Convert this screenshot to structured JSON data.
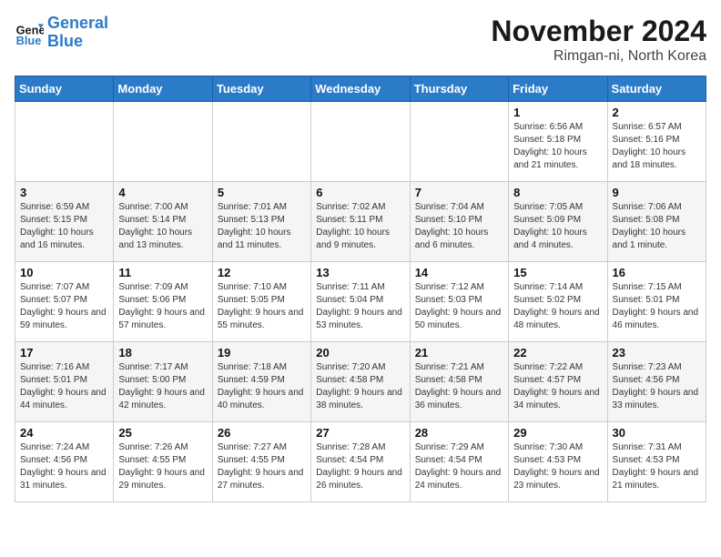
{
  "header": {
    "logo_line1": "General",
    "logo_line2": "Blue",
    "title": "November 2024",
    "subtitle": "Rimgan-ni, North Korea"
  },
  "days_of_week": [
    "Sunday",
    "Monday",
    "Tuesday",
    "Wednesday",
    "Thursday",
    "Friday",
    "Saturday"
  ],
  "weeks": [
    [
      {
        "day": "",
        "info": ""
      },
      {
        "day": "",
        "info": ""
      },
      {
        "day": "",
        "info": ""
      },
      {
        "day": "",
        "info": ""
      },
      {
        "day": "",
        "info": ""
      },
      {
        "day": "1",
        "info": "Sunrise: 6:56 AM\nSunset: 5:18 PM\nDaylight: 10 hours and 21 minutes."
      },
      {
        "day": "2",
        "info": "Sunrise: 6:57 AM\nSunset: 5:16 PM\nDaylight: 10 hours and 18 minutes."
      }
    ],
    [
      {
        "day": "3",
        "info": "Sunrise: 6:59 AM\nSunset: 5:15 PM\nDaylight: 10 hours and 16 minutes."
      },
      {
        "day": "4",
        "info": "Sunrise: 7:00 AM\nSunset: 5:14 PM\nDaylight: 10 hours and 13 minutes."
      },
      {
        "day": "5",
        "info": "Sunrise: 7:01 AM\nSunset: 5:13 PM\nDaylight: 10 hours and 11 minutes."
      },
      {
        "day": "6",
        "info": "Sunrise: 7:02 AM\nSunset: 5:11 PM\nDaylight: 10 hours and 9 minutes."
      },
      {
        "day": "7",
        "info": "Sunrise: 7:04 AM\nSunset: 5:10 PM\nDaylight: 10 hours and 6 minutes."
      },
      {
        "day": "8",
        "info": "Sunrise: 7:05 AM\nSunset: 5:09 PM\nDaylight: 10 hours and 4 minutes."
      },
      {
        "day": "9",
        "info": "Sunrise: 7:06 AM\nSunset: 5:08 PM\nDaylight: 10 hours and 1 minute."
      }
    ],
    [
      {
        "day": "10",
        "info": "Sunrise: 7:07 AM\nSunset: 5:07 PM\nDaylight: 9 hours and 59 minutes."
      },
      {
        "day": "11",
        "info": "Sunrise: 7:09 AM\nSunset: 5:06 PM\nDaylight: 9 hours and 57 minutes."
      },
      {
        "day": "12",
        "info": "Sunrise: 7:10 AM\nSunset: 5:05 PM\nDaylight: 9 hours and 55 minutes."
      },
      {
        "day": "13",
        "info": "Sunrise: 7:11 AM\nSunset: 5:04 PM\nDaylight: 9 hours and 53 minutes."
      },
      {
        "day": "14",
        "info": "Sunrise: 7:12 AM\nSunset: 5:03 PM\nDaylight: 9 hours and 50 minutes."
      },
      {
        "day": "15",
        "info": "Sunrise: 7:14 AM\nSunset: 5:02 PM\nDaylight: 9 hours and 48 minutes."
      },
      {
        "day": "16",
        "info": "Sunrise: 7:15 AM\nSunset: 5:01 PM\nDaylight: 9 hours and 46 minutes."
      }
    ],
    [
      {
        "day": "17",
        "info": "Sunrise: 7:16 AM\nSunset: 5:01 PM\nDaylight: 9 hours and 44 minutes."
      },
      {
        "day": "18",
        "info": "Sunrise: 7:17 AM\nSunset: 5:00 PM\nDaylight: 9 hours and 42 minutes."
      },
      {
        "day": "19",
        "info": "Sunrise: 7:18 AM\nSunset: 4:59 PM\nDaylight: 9 hours and 40 minutes."
      },
      {
        "day": "20",
        "info": "Sunrise: 7:20 AM\nSunset: 4:58 PM\nDaylight: 9 hours and 38 minutes."
      },
      {
        "day": "21",
        "info": "Sunrise: 7:21 AM\nSunset: 4:58 PM\nDaylight: 9 hours and 36 minutes."
      },
      {
        "day": "22",
        "info": "Sunrise: 7:22 AM\nSunset: 4:57 PM\nDaylight: 9 hours and 34 minutes."
      },
      {
        "day": "23",
        "info": "Sunrise: 7:23 AM\nSunset: 4:56 PM\nDaylight: 9 hours and 33 minutes."
      }
    ],
    [
      {
        "day": "24",
        "info": "Sunrise: 7:24 AM\nSunset: 4:56 PM\nDaylight: 9 hours and 31 minutes."
      },
      {
        "day": "25",
        "info": "Sunrise: 7:26 AM\nSunset: 4:55 PM\nDaylight: 9 hours and 29 minutes."
      },
      {
        "day": "26",
        "info": "Sunrise: 7:27 AM\nSunset: 4:55 PM\nDaylight: 9 hours and 27 minutes."
      },
      {
        "day": "27",
        "info": "Sunrise: 7:28 AM\nSunset: 4:54 PM\nDaylight: 9 hours and 26 minutes."
      },
      {
        "day": "28",
        "info": "Sunrise: 7:29 AM\nSunset: 4:54 PM\nDaylight: 9 hours and 24 minutes."
      },
      {
        "day": "29",
        "info": "Sunrise: 7:30 AM\nSunset: 4:53 PM\nDaylight: 9 hours and 23 minutes."
      },
      {
        "day": "30",
        "info": "Sunrise: 7:31 AM\nSunset: 4:53 PM\nDaylight: 9 hours and 21 minutes."
      }
    ]
  ]
}
